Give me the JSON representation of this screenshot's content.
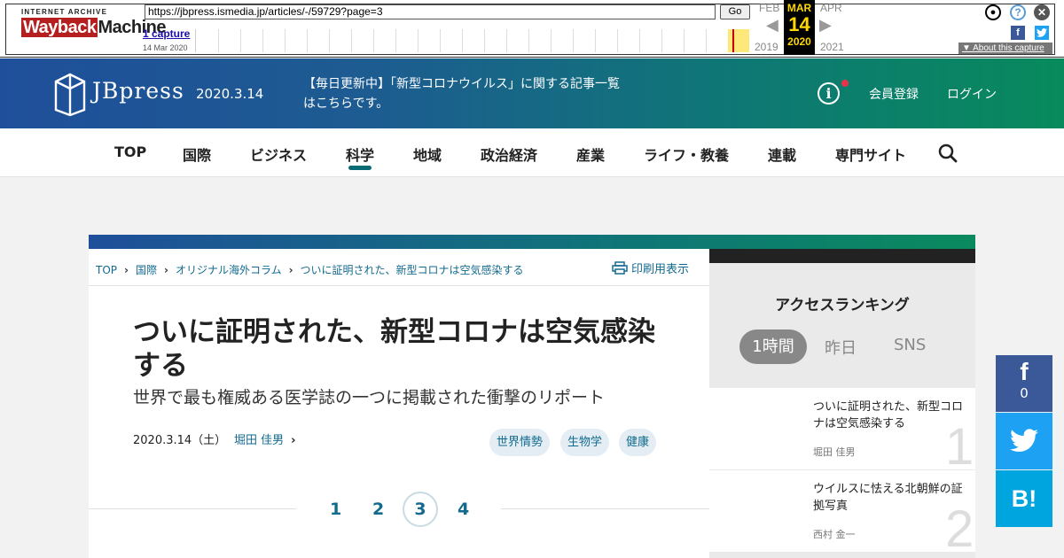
{
  "wayback": {
    "logo_top": "INTERNET ARCHIVE",
    "logo_wayback": "Wayback",
    "logo_machine": "Machine",
    "url": "https://jbpress.ismedia.jp/articles/-/59729?page=3",
    "go_label": "Go",
    "captures_label": "1 capture",
    "capture_date": "14 Mar 2020",
    "prev_month": "FEB",
    "prev_year": "2019",
    "cur_month": "MAR",
    "cur_day": "14",
    "cur_year": "2020",
    "next_month": "APR",
    "next_year": "2021",
    "about_label": "About this capture",
    "colors": {
      "facebook": "#3b5998",
      "twitter": "#1da1f2",
      "calendar_bg": "#000000",
      "calendar_fg": "#ffd700"
    }
  },
  "header": {
    "logo_text": "JBpress",
    "date": "2020.3.14",
    "news": "【毎日更新中】「新型コロナウイルス」に関する記事一覧はこちらです。",
    "register": "会員登録",
    "login": "ログイン",
    "info_glyph": "i"
  },
  "nav": {
    "items": [
      "TOP",
      "国際",
      "ビジネス",
      "科学",
      "地域",
      "政治経済",
      "産業",
      "ライフ・教養",
      "連載",
      "専門サイト"
    ],
    "active": "科学"
  },
  "article": {
    "breadcrumb": [
      "TOP",
      "国際",
      "オリジナル海外コラム",
      "ついに証明された、新型コロナは空気感染する"
    ],
    "print_label": "印刷用表示",
    "title": "ついに証明された、新型コロナは空気感染する",
    "subtitle": "世界で最も権威ある医学誌の一つに掲載された衝撃のリポート",
    "date": "2020.3.14（土）",
    "author": "堀田 佳男",
    "tags": [
      "世界情勢",
      "生物学",
      "健康"
    ],
    "pages": [
      "1",
      "2",
      "3",
      "4"
    ],
    "current_page": "3"
  },
  "sidebar": {
    "title": "アクセスランキング",
    "tabs": [
      "1時間",
      "昨日",
      "SNS"
    ],
    "active_tab": "1時間",
    "ranking": [
      {
        "rank": "1",
        "title": "ついに証明された、新型コロナは空気感染する",
        "author": "堀田 佳男"
      },
      {
        "rank": "2",
        "title": "ウイルスに怯える北朝鮮の証拠写真",
        "author": "西村 金一"
      }
    ]
  },
  "share": {
    "facebook_count": "0",
    "hatena_label": "B!",
    "colors": {
      "facebook": "#3b5998",
      "twitter": "#1da1f2",
      "hatena": "#00a4de"
    }
  },
  "colors": {
    "accent": "#136a8f",
    "nav_active": "#0a6b74"
  }
}
